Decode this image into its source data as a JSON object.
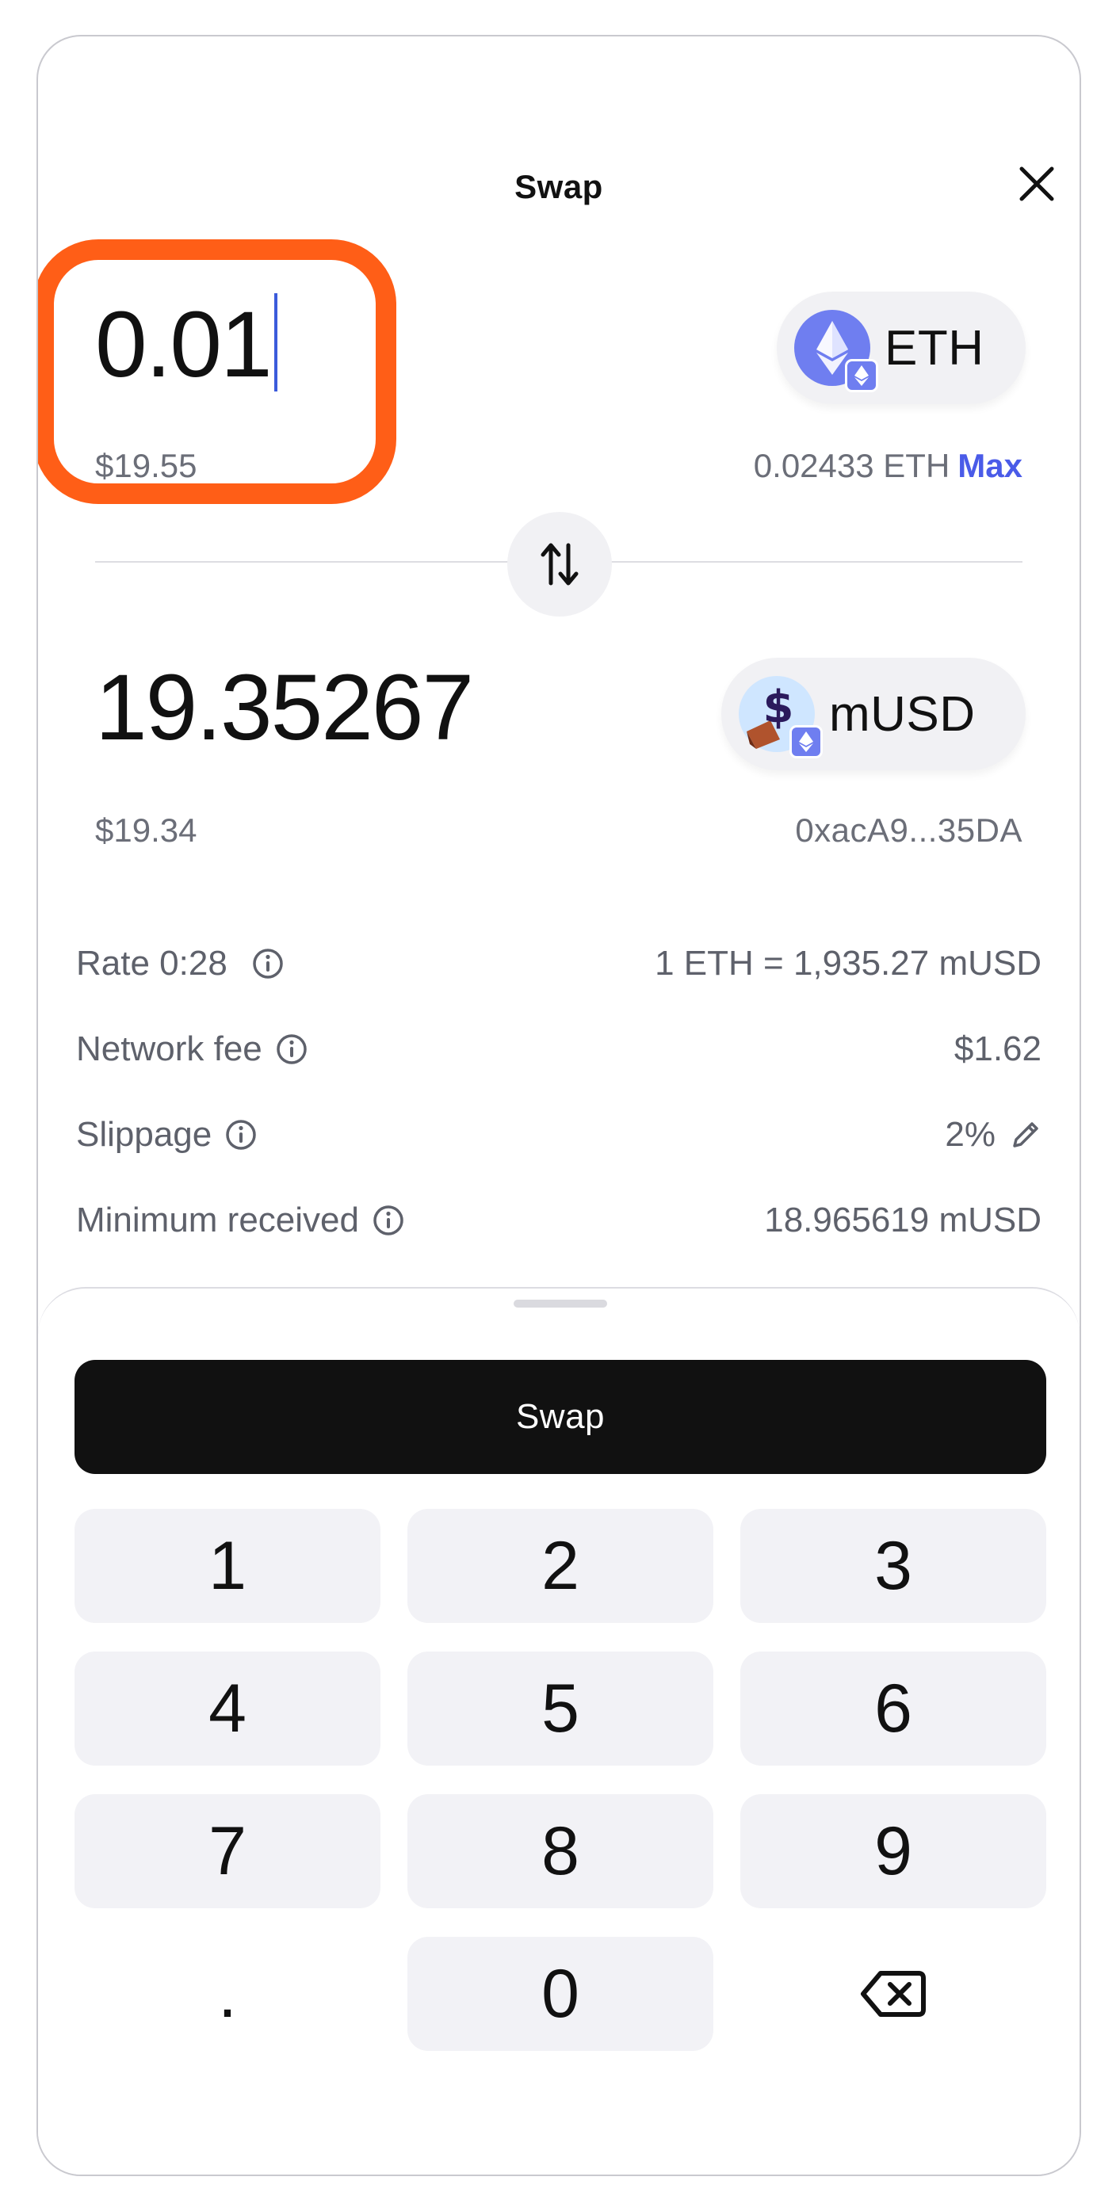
{
  "header": {
    "title": "Swap"
  },
  "from": {
    "amount": "0.01",
    "fiat": "$19.55",
    "token": "ETH",
    "balance": "0.02433 ETH",
    "max_label": "Max"
  },
  "to": {
    "amount": "19.35267",
    "fiat": "$19.34",
    "token": "mUSD",
    "address": "0xacA9...35DA"
  },
  "details": {
    "rate_label": "Rate 0:28",
    "rate_value": "1 ETH = 1,935.27 mUSD",
    "fee_label": "Network fee",
    "fee_value": "$1.62",
    "slippage_label": "Slippage",
    "slippage_value": "2%",
    "min_label": "Minimum received",
    "min_value": "18.965619 mUSD"
  },
  "action": {
    "swap_label": "Swap"
  },
  "keypad": {
    "k1": "1",
    "k2": "2",
    "k3": "3",
    "k4": "4",
    "k5": "5",
    "k6": "6",
    "k7": "7",
    "k8": "8",
    "k9": "9",
    "dot": ".",
    "k0": "0"
  },
  "icons": {
    "close": "close-icon",
    "swap_direction": "arrows-up-down-icon",
    "info": "info-icon",
    "edit": "pencil-icon",
    "backspace": "backspace-icon",
    "eth": "ethereum-icon",
    "musd": "musd-token-icon"
  },
  "colors": {
    "accent": "#4a5be8",
    "highlight": "#ff5e17",
    "primary_button": "#111111",
    "key_background": "#f2f2f6"
  }
}
